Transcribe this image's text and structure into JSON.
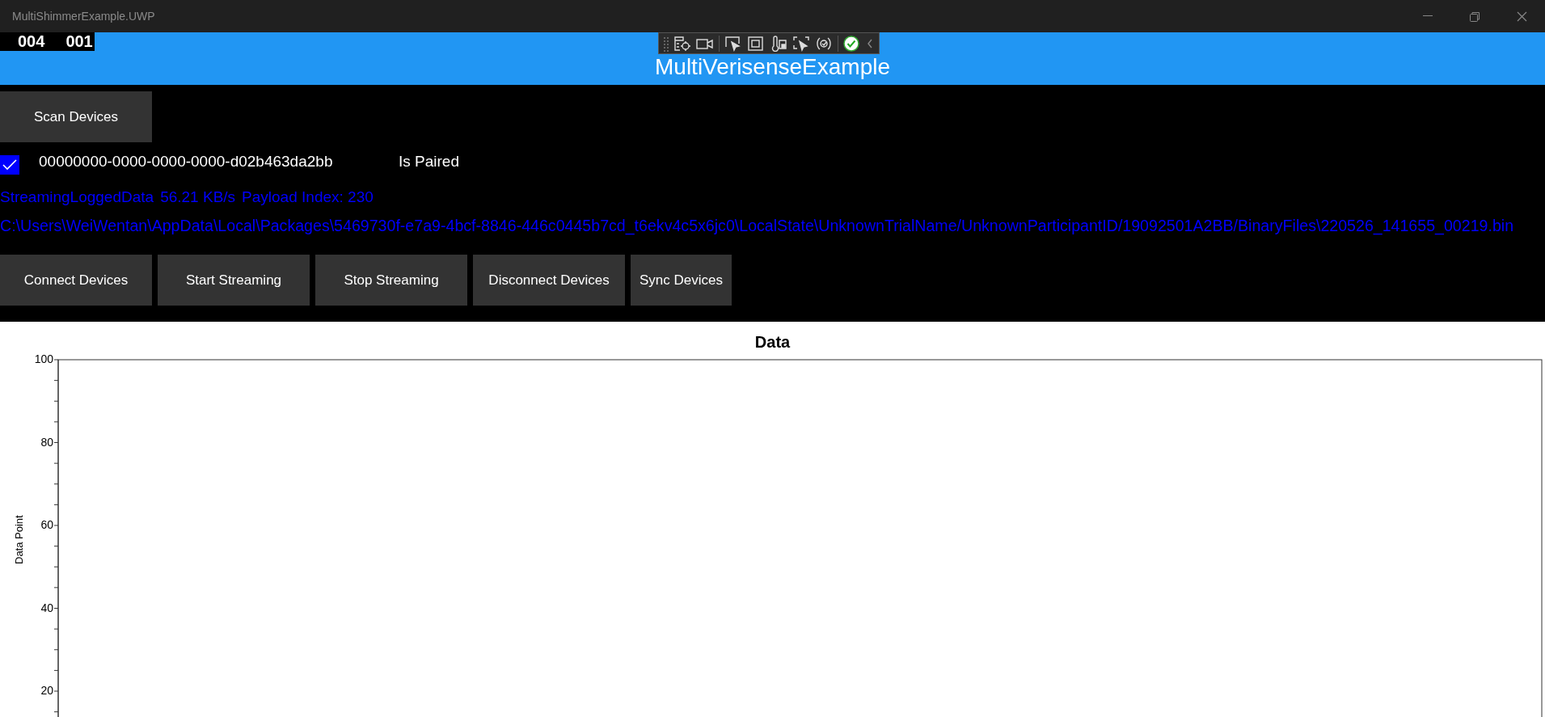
{
  "window": {
    "title": "MultiShimmerExample.UWP"
  },
  "frame_counters": [
    "004",
    "001"
  ],
  "header": {
    "title": "MultiVerisenseExample"
  },
  "scan_button": "Scan Devices",
  "devices": [
    {
      "checked": true,
      "id": "00000000-0000-0000-0000-d02b463da2bb",
      "status": "Is Paired"
    }
  ],
  "status": [
    "StreamingLoggedData",
    "56.21 KB/s",
    "Payload Index: 230"
  ],
  "file_path": "C:\\Users\\WeiWentan\\AppData\\Local\\Packages\\5469730f-e7a9-4bcf-8846-446c0445b7cd_t6ekv4c5x6jc0\\LocalState\\UnknownTrialName/UnknownParticipantID/19092501A2BB/BinaryFiles\\220526_141655_00219.bin",
  "action_buttons": [
    "Connect Devices",
    "Start Streaming",
    "Stop Streaming",
    "Disconnect Devices",
    "Sync Devices"
  ],
  "chart": {
    "title": "Data",
    "y_axis_label": "Data Point",
    "y_ticks": [
      "100",
      "80",
      "60",
      "40",
      "20"
    ]
  }
}
